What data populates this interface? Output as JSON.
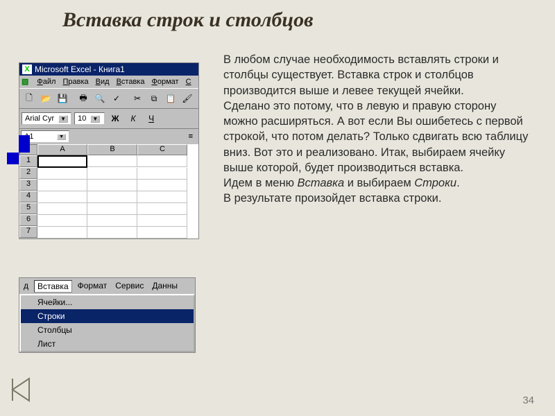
{
  "title": "Вставка строк и столбцов",
  "excel1": {
    "title": "Microsoft Excel - Книга1",
    "menu": [
      "Файл",
      "Правка",
      "Вид",
      "Вставка",
      "Формат",
      "С"
    ],
    "font": "Arial Cyr",
    "fontSize": "10",
    "btnBold": "Ж",
    "btnItalic": "К",
    "btnUnderline": "Ч",
    "namebox": "A1",
    "formulaEq": "=",
    "cols": [
      "A",
      "B",
      "C"
    ],
    "rows": [
      "1",
      "2",
      "3",
      "4",
      "5",
      "6",
      "7"
    ]
  },
  "excel2": {
    "menu_prefix": "д",
    "menu": [
      "Вставка",
      "Формат",
      "Сервис",
      "Данны"
    ],
    "items": [
      "Ячейки...",
      "Строки",
      "Столбцы",
      "Лист"
    ]
  },
  "body": {
    "p1": "В любом случае необходимость вставлять строки и столбцы существует. Вставка строк и столбцов производится выше и левее текущей ячейки.",
    "p2a": "Сделано это потому, что в левую и правую сторону можно расширяться. А вот если Вы ошибетесь с первой строкой, что потом делать? Только сдвигать всю таблицу вниз. Вот это и реализовано. Итак, выбираем ячейку выше которой, будет производиться вставка.",
    "p3a": "Идем в меню ",
    "p3b": "Вставка",
    "p3c": " и выбираем ",
    "p3d": "Строки",
    "p3e": ".",
    "p4": "В результате произойдет вставка строки."
  },
  "page": "34"
}
